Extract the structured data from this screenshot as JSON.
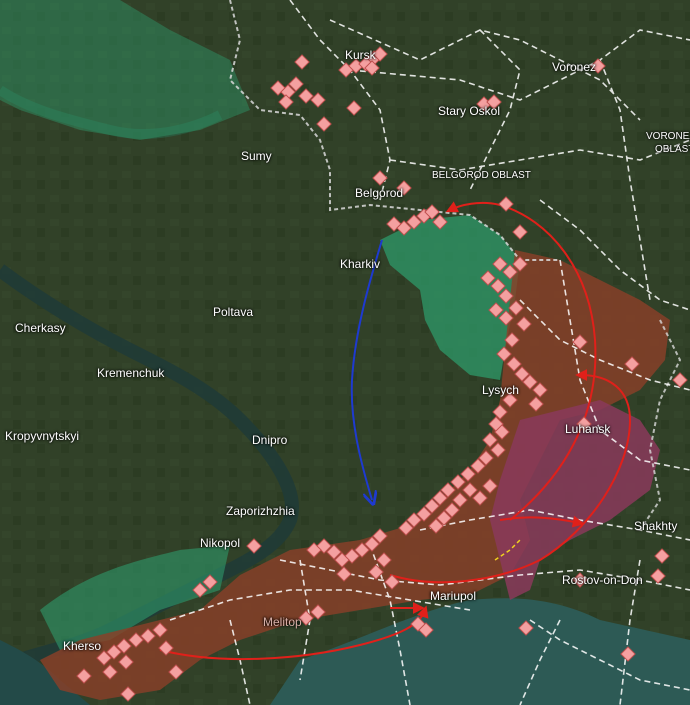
{
  "map": {
    "colors": {
      "land_dark": "#2b3a22",
      "land_mid": "#3a4a2b",
      "water": "#1f3d3a",
      "sea": "#2d5a55",
      "ukraine_control_green": "#2e9a6a",
      "occupied_brown": "#8a3f28",
      "lnr_purple": "#8a3a5a",
      "attack_red": "#e0201a",
      "attack_blue": "#1e3ad0",
      "strike_marker": "#f4a0a0",
      "road_dashed": "#ffffff"
    },
    "labels": {
      "kursk": "Kursk",
      "voronezh": "Voronez",
      "stary_oskol": "Stary Oskol",
      "voronezh_oblast": "VORONEZ",
      "voronezh_oblast_2": "OBLAST",
      "sumy": "Sumy",
      "belgorod": "Belgorod",
      "belgorod_oblast": "BELGOROD OBLAST",
      "kharkiv": "Kharkiv",
      "poltava": "Poltava",
      "cherkasy": "Cherkasy",
      "kremenchuk": "Kremenchuk",
      "kropyvnytskyi": "Kropyvnytskyi",
      "dnipro": "Dnipro",
      "lysychansk": "Lysych",
      "luhansk": "Luhansk",
      "zaporizhzhia": "Zaporizhzhia",
      "nikopol": "Nikopol",
      "shakhty": "Shakhty",
      "rostov": "Rostov-on-Don",
      "mariupol": "Mariupol",
      "melitopol": "Melitop",
      "kherson": "Kherso"
    },
    "icons": [
      "strike-marker-icon",
      "explosion-marker-icon",
      "arrowhead-icon"
    ]
  }
}
